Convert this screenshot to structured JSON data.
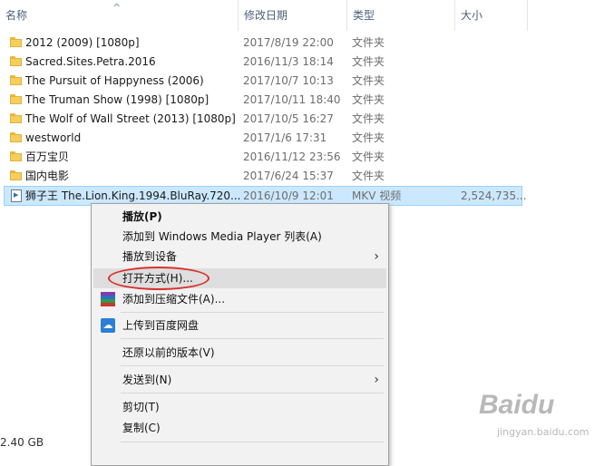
{
  "header": {
    "name": "名称",
    "date": "修改日期",
    "type": "类型",
    "size": "大小",
    "sort_arrow": "^"
  },
  "files": [
    {
      "icon": "folder-icon",
      "name": "2012 (2009) [1080p]",
      "date": "2017/8/19 22:00",
      "type": "文件夹",
      "size": ""
    },
    {
      "icon": "folder-icon",
      "name": "Sacred.Sites.Petra.2016",
      "date": "2016/11/3 18:14",
      "type": "文件夹",
      "size": ""
    },
    {
      "icon": "folder-icon",
      "name": "The Pursuit of Happyness (2006)",
      "date": "2017/10/7 10:13",
      "type": "文件夹",
      "size": ""
    },
    {
      "icon": "folder-icon",
      "name": "The Truman Show (1998) [1080p]",
      "date": "2017/10/11 18:40",
      "type": "文件夹",
      "size": ""
    },
    {
      "icon": "folder-icon",
      "name": "The Wolf of Wall Street (2013) [1080p]",
      "date": "2017/10/5 16:27",
      "type": "文件夹",
      "size": ""
    },
    {
      "icon": "folder-icon",
      "name": "westworld",
      "date": "2017/1/6 17:31",
      "type": "文件夹",
      "size": ""
    },
    {
      "icon": "folder-icon",
      "name": "百万宝贝",
      "date": "2016/11/12 23:56",
      "type": "文件夹",
      "size": ""
    },
    {
      "icon": "folder-icon",
      "name": "国内电影",
      "date": "2017/6/24 15:37",
      "type": "文件夹",
      "size": ""
    },
    {
      "icon": "video-file-icon",
      "name": "狮子王 The.Lion.King.1994.BluRay.720...",
      "date": "2016/10/9 12:01",
      "type": "MKV 视频",
      "size": "2,524,735...",
      "selected": true
    }
  ],
  "context_menu": {
    "items": [
      {
        "label": "播放(P)",
        "bold": true
      },
      {
        "label": "添加到 Windows Media Player 列表(A)"
      },
      {
        "label": "播放到设备",
        "submenu": true
      },
      {
        "label": "打开方式(H)...",
        "highlighted": true
      },
      {
        "label": "添加到压缩文件(A)...",
        "icon": "winrar-icon"
      },
      {
        "label": "上传到百度网盘",
        "icon": "baidu-cloud-icon"
      },
      {
        "label": "还原以前的版本(V)"
      },
      {
        "label": "发送到(N)",
        "submenu": true
      },
      {
        "label": "剪切(T)"
      },
      {
        "label": "复制(C)"
      }
    ],
    "submenu_arrow": "›"
  },
  "status_bar": {
    "size_text": "2.40 GB"
  },
  "watermark": {
    "brand": "Baidu",
    "url": "jingyan.baidu.com"
  },
  "colors": {
    "selection_bg": "#cce8ff",
    "highlight_oval": "#d8312f",
    "folder": "#f5cf5b"
  }
}
